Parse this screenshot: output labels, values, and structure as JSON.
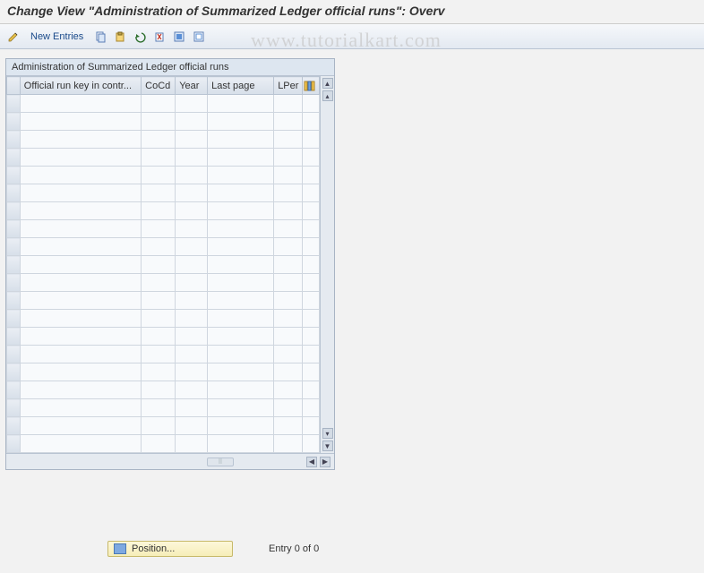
{
  "title": "Change View \"Administration of Summarized Ledger official runs\": Overv",
  "watermark": "www.tutorialkart.com",
  "toolbar": {
    "new_entries": "New Entries",
    "icons": [
      "pencil-icon",
      "copy-icon",
      "paste-icon",
      "undo-icon",
      "delete-icon",
      "select-all-icon",
      "deselect-all-icon"
    ]
  },
  "panel": {
    "title": "Administration of Summarized Ledger official runs",
    "columns": [
      "Official run key in contr...",
      "CoCd",
      "Year",
      "Last page",
      "LPer"
    ],
    "row_count": 20
  },
  "footer": {
    "position_label": "Position...",
    "entry_text": "Entry 0 of 0"
  }
}
